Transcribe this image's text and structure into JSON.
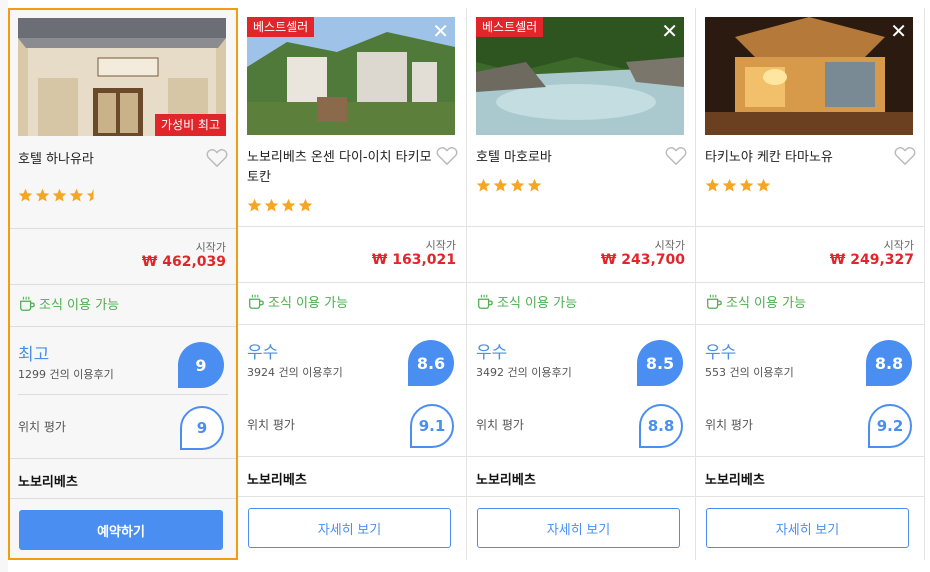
{
  "hotels": [
    {
      "name": "호텔 하나유라",
      "badge_bottom": "가성비 최고",
      "badge_top": "",
      "stars": 4.5,
      "price_label": "시작가",
      "price": "₩ 462,039",
      "breakfast": "조식 이용 가능",
      "rating_word": "최고",
      "reviews": "1299 건의 이용후기",
      "score": "9",
      "location_label": "위치 평가",
      "location_score": "9",
      "provider": "노보리베츠",
      "button": "예약하기",
      "selected": true
    },
    {
      "name": "노보리베츠 온센 다이-이치 타키모토칸",
      "badge_bottom": "",
      "badge_top": "베스트셀러",
      "close": "✕",
      "stars": 4,
      "price_label": "시작가",
      "price": "₩ 163,021",
      "breakfast": "조식 이용 가능",
      "rating_word": "우수",
      "reviews": "3924 건의 이용후기",
      "score": "8.6",
      "location_label": "위치 평가",
      "location_score": "9.1",
      "provider": "노보리베츠",
      "button": "자세히 보기"
    },
    {
      "name": "호텔 마호로바",
      "badge_bottom": "",
      "badge_top": "베스트셀러",
      "close": "✕",
      "stars": 4,
      "price_label": "시작가",
      "price": "₩ 243,700",
      "breakfast": "조식 이용 가능",
      "rating_word": "우수",
      "reviews": "3492 건의 이용후기",
      "score": "8.5",
      "location_label": "위치 평가",
      "location_score": "8.8",
      "provider": "노보리베츠",
      "button": "자세히 보기"
    },
    {
      "name": "타키노야 케칸 타마노유",
      "badge_bottom": "",
      "badge_top": "",
      "close": "✕",
      "stars": 4,
      "price_label": "시작가",
      "price": "₩ 249,327",
      "breakfast": "조식 이용 가능",
      "rating_word": "우수",
      "reviews": "553 건의 이용후기",
      "score": "8.8",
      "location_label": "위치 평가",
      "location_score": "9.2",
      "provider": "노보리베츠",
      "button": "자세히 보기"
    }
  ],
  "colors": {
    "accent": "#4a8ef2",
    "price": "#e0262b",
    "star": "#f5a623",
    "breakfast": "#4caf50",
    "selected_border": "#f39c12"
  }
}
